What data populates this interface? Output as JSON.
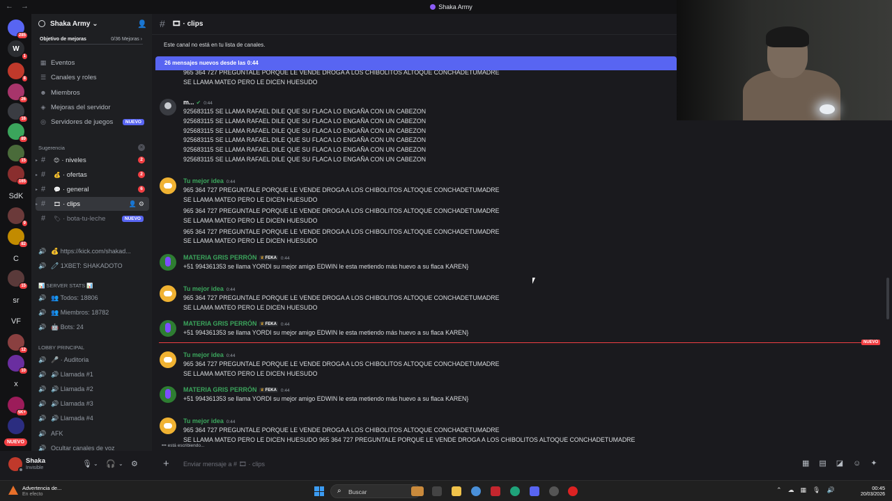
{
  "window": {
    "title": "Shaka Army",
    "nav": "← →"
  },
  "servers": [
    {
      "label": "",
      "badge": "285",
      "color": "#5865f2"
    },
    {
      "label": "W",
      "badge": "1",
      "color": "#2b2d31"
    },
    {
      "label": "",
      "badge": "8",
      "color": "#c0392b"
    },
    {
      "label": "",
      "badge": "26",
      "color": "#a7356b"
    },
    {
      "label": "",
      "badge": "16",
      "color": "#3a3c42"
    },
    {
      "label": "",
      "badge": "89",
      "color": "#3ba55c"
    },
    {
      "label": "",
      "badge": "15",
      "color": "#4a6b3a"
    },
    {
      "label": "",
      "badge": "165",
      "color": "#8a2e2e"
    },
    {
      "label": "SdK",
      "badge": "",
      "color": ""
    },
    {
      "label": "",
      "badge": "9",
      "color": "#6b3a3a"
    },
    {
      "label": "",
      "badge": "82",
      "color": "#c28b00"
    },
    {
      "label": "C",
      "badge": "",
      "color": ""
    },
    {
      "label": "",
      "badge": "15",
      "color": "#5a3a3a"
    },
    {
      "label": "sr",
      "badge": "",
      "color": ""
    },
    {
      "label": "VF",
      "badge": "",
      "color": ""
    },
    {
      "label": "",
      "badge": "12",
      "color": "#8a4040"
    },
    {
      "label": "",
      "badge": "10",
      "color": "#6a2ea0"
    },
    {
      "label": "x",
      "badge": "",
      "color": ""
    },
    {
      "label": "",
      "badge": "5K+",
      "color": "#9c1c5a"
    },
    {
      "label": "",
      "badge": "",
      "color": "#2b2d80"
    }
  ],
  "rail_nuevo": "NUEVO",
  "server": {
    "name": "Shaka Army",
    "boost_label": "Objetivo de mejoras",
    "boost_count": "0/36 Mejoras",
    "menu": [
      {
        "icon": "calendar-icon",
        "glyph": "▦",
        "label": "Eventos",
        "tag": ""
      },
      {
        "icon": "roles-icon",
        "glyph": "☰",
        "label": "Canales y roles",
        "tag": ""
      },
      {
        "icon": "members-icon",
        "glyph": "☻",
        "label": "Miembros",
        "tag": ""
      },
      {
        "icon": "boost-icon",
        "glyph": "◈",
        "label": "Mejoras del servidor",
        "tag": ""
      },
      {
        "icon": "gamepad-icon",
        "glyph": "◎",
        "label": "Servidores de juegos",
        "tag": "NUEVO"
      }
    ],
    "section_suggestion": "Sugerencia",
    "channels": [
      {
        "emoji": "😊",
        "label": "· niveles",
        "count": "2",
        "state": "unread"
      },
      {
        "emoji": "💰",
        "label": "· ofertas",
        "count": "2",
        "state": "unread"
      },
      {
        "emoji": "💬",
        "label": "· general",
        "count": "6",
        "state": "unread"
      },
      {
        "emoji": "🎞",
        "label": "· clips",
        "count": "",
        "state": "active"
      },
      {
        "emoji": "🏷",
        "label": "· bota-tu-leche",
        "count": "",
        "state": "new",
        "tag": "NUEVO"
      }
    ],
    "links": [
      {
        "label": "💰 https://kick.com/shakad..."
      },
      {
        "label": "🧷 1XBET: SHAKADOTO"
      }
    ],
    "stats_section": "📊 SERVER STATS 📊",
    "stats": [
      {
        "label": "👥 Todos: 18806"
      },
      {
        "label": "👥 Miembros: 18782"
      },
      {
        "label": "🤖 Bots: 24"
      }
    ],
    "lobby_section": "LOBBY PRINCIPAL",
    "voice": [
      {
        "label": "🎤 · Auditoria"
      },
      {
        "label": "🔊 Llamada #1"
      },
      {
        "label": "🔊 Llamada #2"
      },
      {
        "label": "🔊 Llamada #3"
      },
      {
        "label": "🔊 Llamada #4"
      },
      {
        "label": "AFK"
      },
      {
        "label": "Ocultar canales de voz"
      }
    ]
  },
  "user": {
    "name": "Shaka",
    "status": "Invisible"
  },
  "channel": {
    "name": "· clips",
    "notice": "Este canal no está en tu lista de canales.",
    "new_bar": "26 mensajes nuevos desde las 0:44"
  },
  "messages": [
    {
      "author": "",
      "time": "",
      "kind": "cont",
      "lines": [
        "965 364 727  PREGUNTALE PORQUE LE VENDE DROGA A LOS CHIBOLITOS ALTOQUE CONCHADETUMADRE",
        "SE LLAMA MATEO PERO LE DICEN HUESUDO"
      ]
    },
    {
      "author": "m...",
      "time": "0:44",
      "kind": "gray",
      "verified": true,
      "lines": [
        "925683115 SE LLAMA RAFAEL DILE QUE SU FLACA LO ENGAÑA CON UN CABEZON",
        "925683115 SE LLAMA RAFAEL DILE QUE SU FLACA LO ENGAÑA CON UN CABEZON",
        "925683115 SE LLAMA RAFAEL DILE QUE SU FLACA LO ENGAÑA CON UN CABEZON",
        "925683115 SE LLAMA RAFAEL DILE QUE SU FLACA LO ENGAÑA CON UN CABEZON",
        "925683115 SE LLAMA RAFAEL DILE QUE SU FLACA LO ENGAÑA CON UN CABEZON",
        "925683115 SE LLAMA RAFAEL DILE QUE SU FLACA LO ENGAÑA CON UN CABEZON"
      ]
    },
    {
      "author": "Tu mejor idea",
      "time": "0:44",
      "kind": "discord",
      "lines": [
        "965 364 727  PREGUNTALE PORQUE LE VENDE DROGA A LOS CHIBOLITOS ALTOQUE CONCHADETUMADRE",
        "SE LLAMA MATEO PERO LE DICEN HUESUDO",
        "965 364 727  PREGUNTALE PORQUE LE VENDE DROGA A LOS CHIBOLITOS ALTOQUE CONCHADETUMADRE",
        "SE LLAMA MATEO PERO LE DICEN HUESUDO",
        "965 364 727  PREGUNTALE PORQUE LE VENDE DROGA A LOS CHIBOLITOS ALTOQUE CONCHADETUMADRE",
        "SE LLAMA MATEO PERO LE DICEN HUESUDO"
      ]
    },
    {
      "author": "MATERIA GRIS PERRÓN",
      "time": "0:44",
      "kind": "green",
      "tag": "FEKA",
      "lines": [
        "+51 994361353 se llama YORDI su mejor amigo EDWIN le esta metiendo más huevo a su flaca KAREN}"
      ]
    },
    {
      "author": "Tu mejor idea",
      "time": "0:44",
      "kind": "discord",
      "lines": [
        "965 364 727  PREGUNTALE PORQUE LE VENDE DROGA A LOS CHIBOLITOS ALTOQUE CONCHADETUMADRE",
        "SE LLAMA MATEO PERO LE DICEN HUESUDO"
      ]
    },
    {
      "author": "MATERIA GRIS PERRÓN",
      "time": "0:44",
      "kind": "green",
      "tag": "FEKA",
      "lines": [
        "+51 994361353 se llama YORDI su mejor amigo EDWIN le esta metiendo más huevo a su flaca KAREN}"
      ]
    },
    {
      "author": "Tu mejor idea",
      "time": "0:44",
      "kind": "discord",
      "lines": [
        "965 364 727  PREGUNTALE PORQUE LE VENDE DROGA A LOS CHIBOLITOS ALTOQUE CONCHADETUMADRE",
        "SE LLAMA MATEO PERO LE DICEN HUESUDO"
      ]
    },
    {
      "author": "MATERIA GRIS PERRÓN",
      "time": "0:44",
      "kind": "green",
      "tag": "FEKA",
      "lines": [
        "+51 994361353 se llama YORDI su mejor amigo EDWIN le esta metiendo más huevo a su flaca KAREN}"
      ]
    },
    {
      "author": "Tu mejor idea",
      "time": "0:44",
      "kind": "discord",
      "lines": [
        "965 364 727  PREGUNTALE PORQUE LE VENDE DROGA A LOS CHIBOLITOS ALTOQUE CONCHADETUMADRE",
        "SE LLAMA MATEO PERO LE DICEN HUESUDO 965 364 727  PREGUNTALE PORQUE LE VENDE DROGA A LOS CHIBOLITOS ALTOQUE CONCHADETUMADRE"
      ]
    }
  ],
  "new_divider": "NUEVO",
  "typing": "está escribiendo...",
  "composer": {
    "placeholder": "Enviar mensaje a # 🎞 · clips"
  },
  "taskbar": {
    "warning_title": "Advertencia de...",
    "warning_sub": "En efecto",
    "search": "Buscar",
    "time": "00:45",
    "date": "20/03/2026"
  }
}
